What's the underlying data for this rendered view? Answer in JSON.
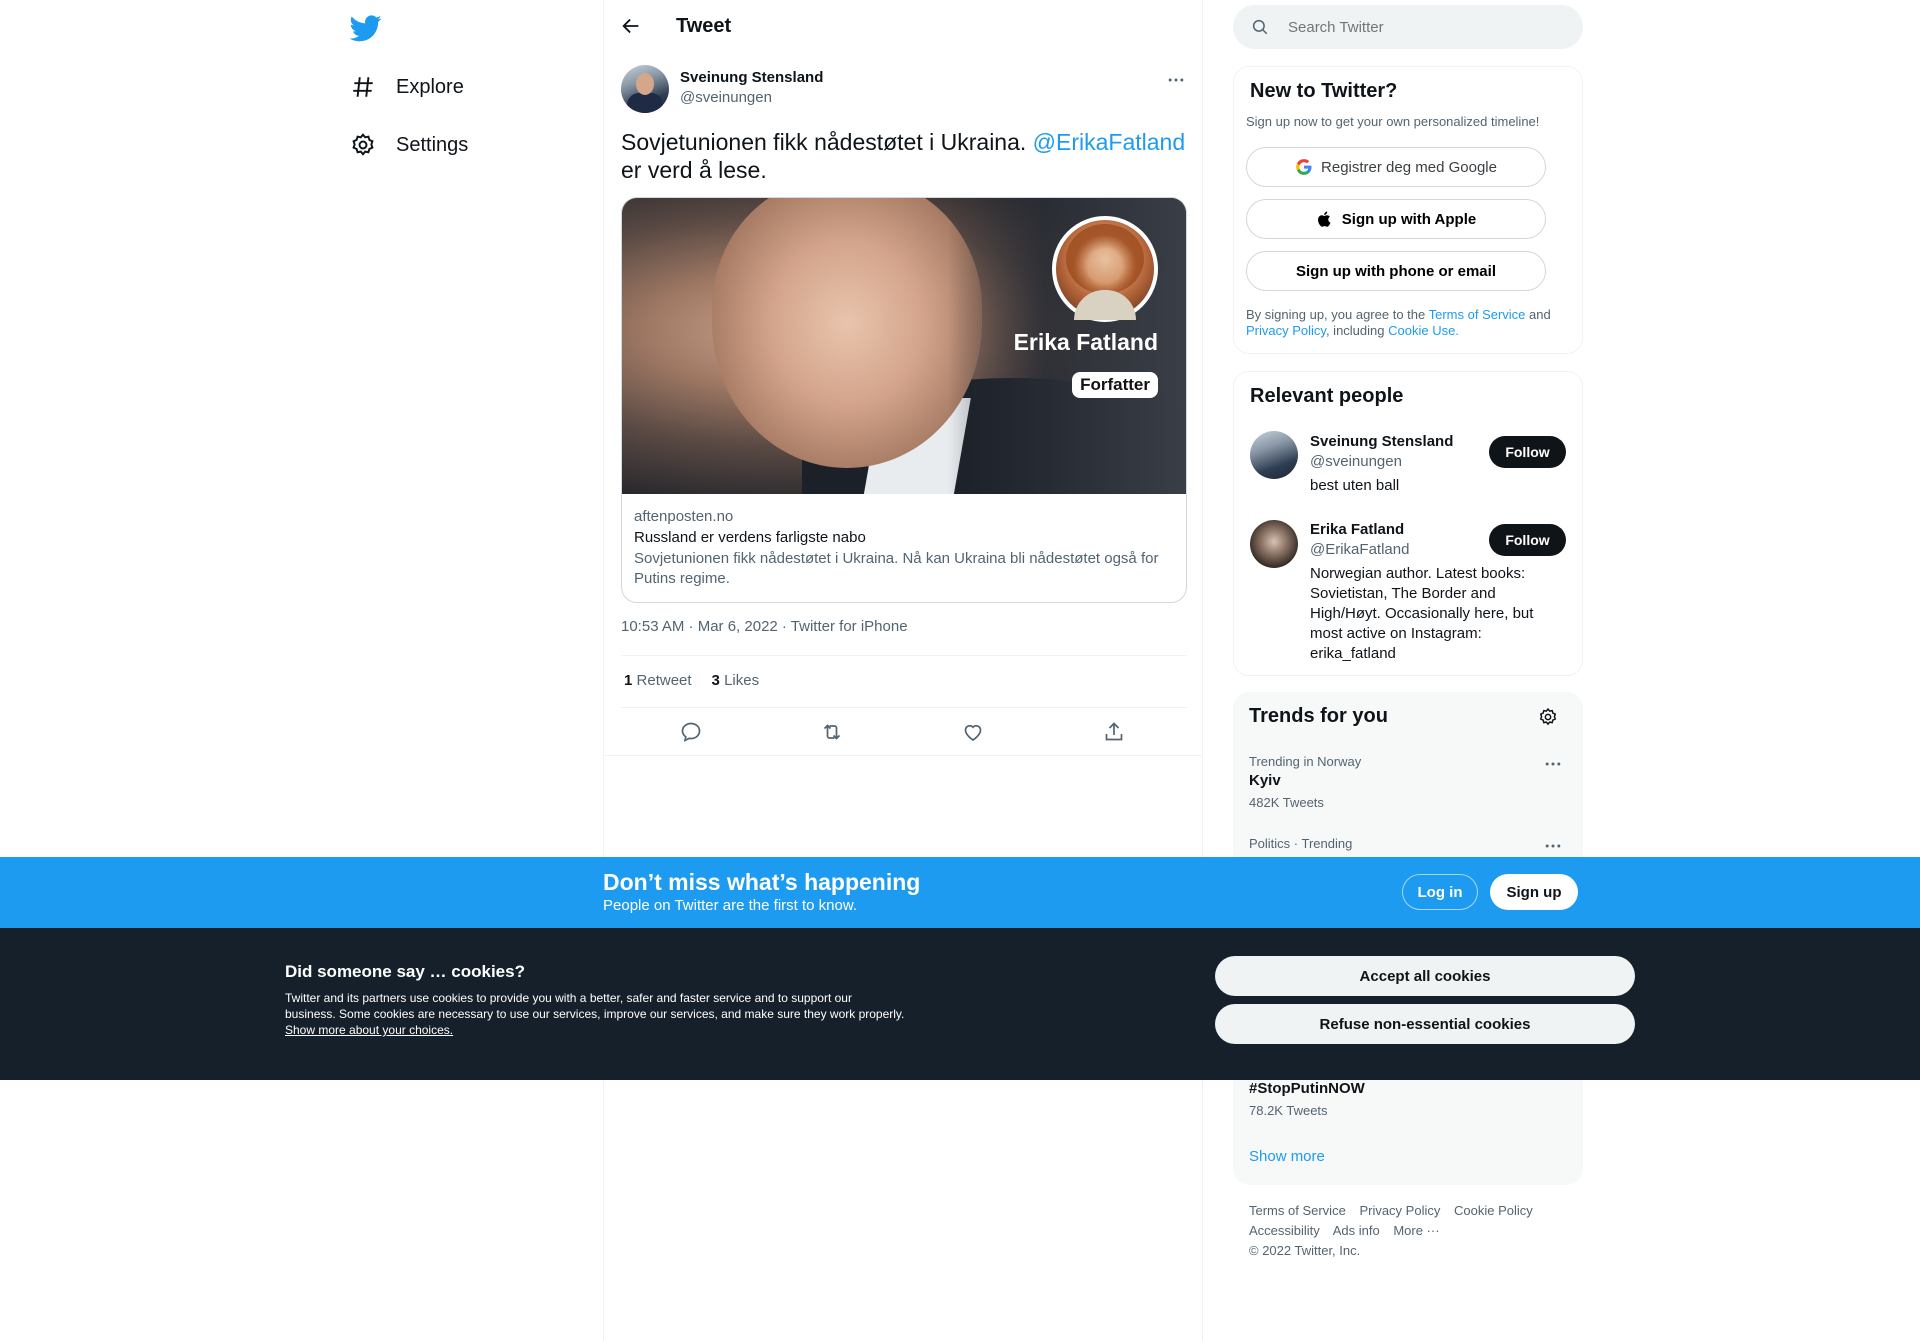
{
  "nav": {
    "explore": "Explore",
    "settings": "Settings"
  },
  "header": {
    "title": "Tweet"
  },
  "tweet": {
    "author_name": "Sveinung Stensland",
    "author_handle": "@sveinungen",
    "text_before": "Sovjetunionen fikk nådestøtet i Ukraina. ",
    "mention": "@ErikaFatland",
    "text_after": " er verd å lese.",
    "card": {
      "overlay_name": "Erika Fatland",
      "overlay_tag": "Forfatter",
      "domain": "aftenposten.no",
      "title": "Russland er verdens farligste nabo",
      "description": "Sovjetunionen fikk nådestøtet i Ukraina. Nå kan Ukraina bli nådestøtet også for Putins regime."
    },
    "timestamp": "10:53 AM · Mar 6, 2022 · Twitter for iPhone",
    "retweet_count": "1",
    "retweet_label": "Retweet",
    "like_count": "3",
    "like_label": "Likes"
  },
  "search": {
    "placeholder": "Search Twitter"
  },
  "new_to_twitter": {
    "title": "New to Twitter?",
    "subtitle": "Sign up now to get your own personalized timeline!",
    "google_btn": "Registrer deg med Google",
    "apple_btn": "Sign up with Apple",
    "phone_btn": "Sign up with phone or email",
    "legal_1": "By signing up, you agree to the ",
    "terms": "Terms of Service",
    "legal_2": " and ",
    "privacy": "Privacy Policy",
    "legal_3": ", including ",
    "cookie_use": "Cookie Use."
  },
  "relevant_people": {
    "title": "Relevant people",
    "people": [
      {
        "name": "Sveinung Stensland",
        "handle": "@sveinungen",
        "bio": "best uten ball",
        "follow": "Follow"
      },
      {
        "name": "Erika Fatland",
        "handle": "@ErikaFatland",
        "bio": "Norwegian author. Latest books: Sovietistan, The Border and High/Høyt. Occasionally here, but most active on Instagram: erika_fatland",
        "follow": "Follow"
      }
    ]
  },
  "trends": {
    "title": "Trends for you",
    "items": [
      {
        "meta": "Trending in Norway",
        "name": "Kyiv",
        "count": "482K Tweets"
      },
      {
        "meta": "Politics · Trending",
        "name": "",
        "count": ""
      },
      {
        "meta": "",
        "name": "#StopPutinNOW",
        "count": "78.2K Tweets"
      }
    ],
    "show_more": "Show more"
  },
  "footer": {
    "links": [
      "Terms of Service",
      "Privacy Policy",
      "Cookie Policy",
      "Accessibility",
      "Ads info",
      "More ···"
    ],
    "copyright": "© 2022 Twitter, Inc."
  },
  "signup_bar": {
    "title": "Don’t miss what’s happening",
    "subtitle": "People on Twitter are the first to know.",
    "login": "Log in",
    "signup": "Sign up"
  },
  "cookie_bar": {
    "title": "Did someone say … cookies?",
    "text": "Twitter and its partners use cookies to provide you with a better, safer and faster service and to support our business. Some cookies are necessary to use our services, improve our services, and make sure they work properly. ",
    "link": "Show more about your choices.",
    "accept": "Accept all cookies",
    "refuse": "Refuse non-essential cookies"
  },
  "colors": {
    "accent": "#1d9bf0",
    "text": "#0f1419",
    "muted": "#536471",
    "cookie_bg": "#15202b"
  }
}
